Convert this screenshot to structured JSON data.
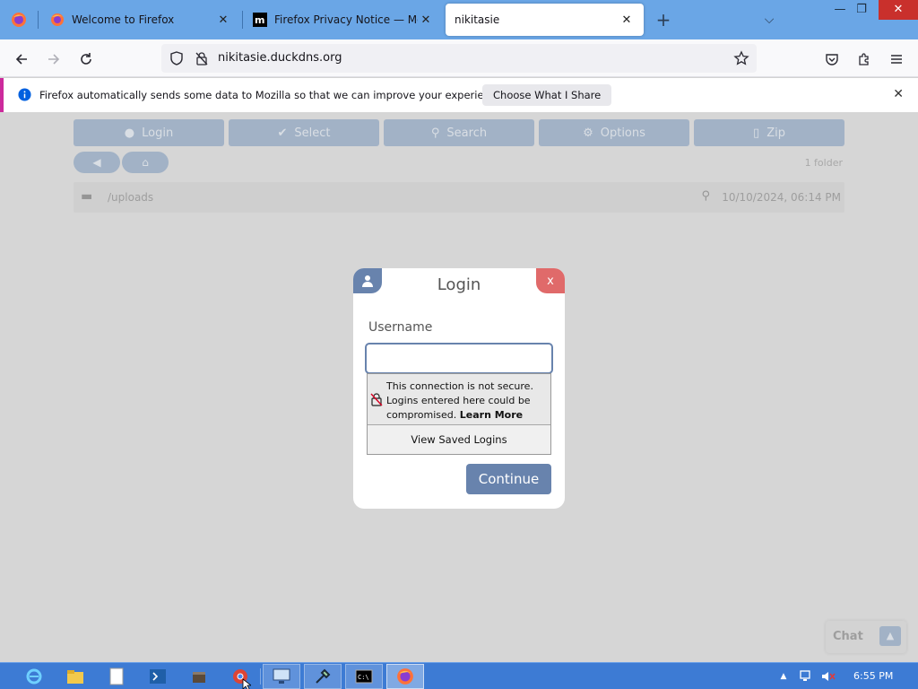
{
  "browser": {
    "tabs": [
      {
        "title": "Welcome to Firefox",
        "active": false
      },
      {
        "title": "Firefox Privacy Notice — Mozilla",
        "active": false
      },
      {
        "title": "nikitasie",
        "active": true
      }
    ],
    "url": "nikitasie.duckdns.org"
  },
  "notification": {
    "message": "Firefox automatically sends some data to Mozilla so that we can improve your experience.",
    "button_label": "Choose What I Share"
  },
  "page": {
    "menu": [
      {
        "label": "Login",
        "icon": "person-icon"
      },
      {
        "label": "Select",
        "icon": "check-icon"
      },
      {
        "label": "Search",
        "icon": "search-icon"
      },
      {
        "label": "Options",
        "icon": "gear-icon"
      },
      {
        "label": "Zip",
        "icon": "file-icon"
      }
    ],
    "folder_count": "1 folder",
    "path_label": "/uploads",
    "timestamp": "10/10/2024, 06:14 PM",
    "chat_label": "Chat"
  },
  "dialog": {
    "title": "Login",
    "close_label": "x",
    "username_label": "Username",
    "username_value": "",
    "continue_label": "Continue"
  },
  "insecure_popup": {
    "message": "This connection is not secure. Logins entered here could be compromised.",
    "learn_more": "Learn More",
    "saved_logins": "View Saved Logins"
  },
  "taskbar": {
    "time": "6:55 PM"
  },
  "colors": {
    "tabstrip": "#6aa6e6",
    "accent": "#6883ad",
    "close": "#e06a6a",
    "taskbar": "#3d7bd4"
  }
}
